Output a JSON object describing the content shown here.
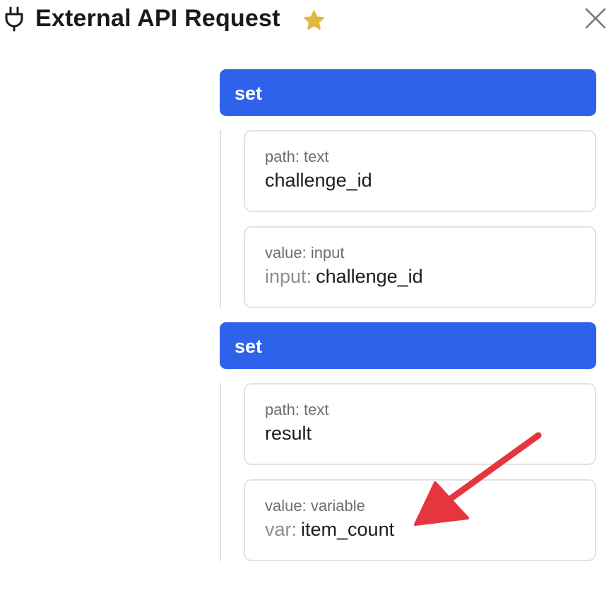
{
  "header": {
    "title": "External API Request",
    "icon": "plug-icon",
    "favorite_icon": "star-icon",
    "close_icon": "close-icon"
  },
  "blocks": [
    {
      "label": "set",
      "path": {
        "label": "path: text",
        "value": "challenge_id"
      },
      "value": {
        "label": "value: input",
        "prefix": "input:",
        "value": "challenge_id"
      }
    },
    {
      "label": "set",
      "path": {
        "label": "path: text",
        "value": "result"
      },
      "value": {
        "label": "value: variable",
        "prefix": "var:",
        "value": "item_count"
      }
    }
  ],
  "colors": {
    "accent": "#2f62eb",
    "star": "#e3b63e",
    "annotation_arrow": "#e5363f"
  }
}
